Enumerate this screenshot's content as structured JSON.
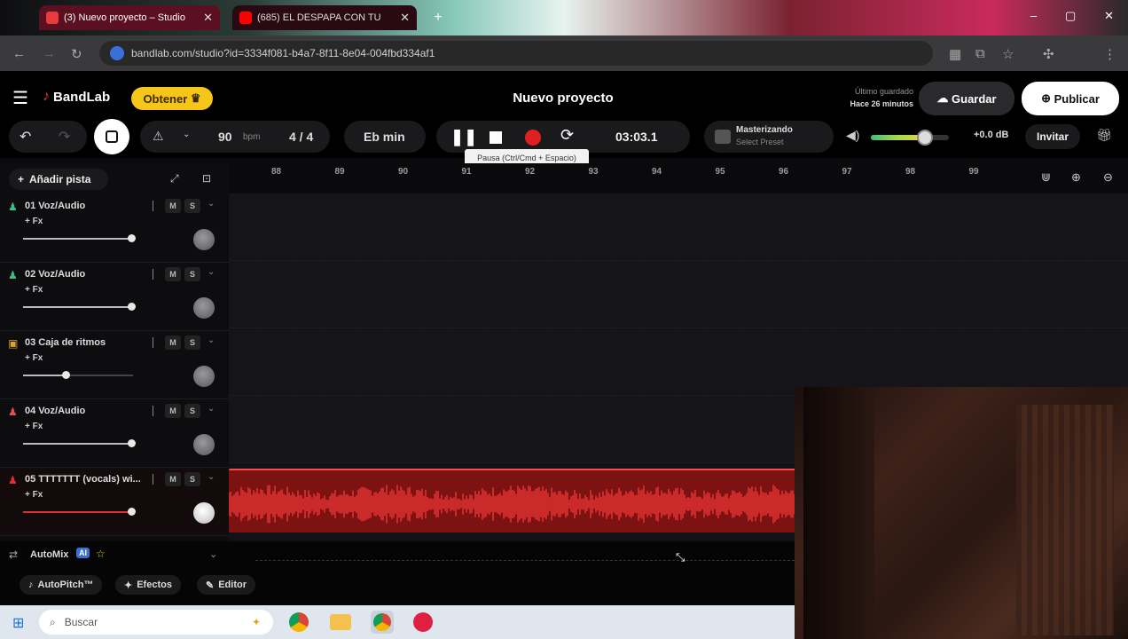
{
  "browser": {
    "tabs": [
      {
        "label": "(3) Nuevo proyecto – Studio",
        "active": true
      },
      {
        "label": "(685) EL DESPAPA CON TU",
        "active": false
      }
    ],
    "new_tab": "+",
    "url": "bandlab.com/studio?id=3334f081-b4a7-8f11-8e04-004fbd334af1",
    "window_controls": [
      "–",
      "▢",
      "✕"
    ]
  },
  "header": {
    "logo": "BandLab",
    "get_button": "Obtener",
    "project_title": "Nuevo proyecto",
    "last_saved_label": "Último guardado",
    "last_saved_value": "Hace 26 minutos",
    "save_button": "Guardar",
    "publish_button": "Publicar"
  },
  "transport": {
    "tempo": "90",
    "tempo_unit": "bpm",
    "time_signature": "4 / 4",
    "key": "Eb min",
    "time": "03:03.1",
    "mastering_title": "Masterizando",
    "mastering_preset": "Select Preset",
    "level": "+0.0 dB",
    "invite_button": "Invitar",
    "tooltip": "Pausa (Ctrl/Cmd + Espacio)"
  },
  "tracks_header": {
    "add_track": "Añadir pista"
  },
  "ruler": [
    "88",
    "89",
    "90",
    "91",
    "92",
    "93",
    "94",
    "95",
    "96",
    "97",
    "98",
    "99"
  ],
  "tracks": [
    {
      "name": "01  Voz/Audio",
      "fx": "+ Fx",
      "color": "#3fbf7f",
      "volume": 0.98
    },
    {
      "name": "02  Voz/Audio",
      "fx": "+ Fx",
      "color": "#3fbf7f",
      "volume": 0.98
    },
    {
      "name": "03  Caja de ritmos",
      "fx": "+ Fx",
      "color": "#e0a030",
      "volume": 0.39
    },
    {
      "name": "04  Voz/Audio",
      "fx": "+ Fx",
      "color": "#e05050",
      "volume": 0.98
    },
    {
      "name": "05  TTTTTTT (vocals) wi...",
      "fx": "+ Fx",
      "color": "#e03030",
      "volume": 0.98
    }
  ],
  "track_buttons": {
    "mute": "M",
    "solo": "S"
  },
  "bottom": {
    "autotune_label": "AutoMix",
    "autotune_badge": "AI",
    "autopitch": "AutoPitch™",
    "effects": "Efectos",
    "editor": "Editor"
  },
  "taskbar": {
    "search_placeholder": "Buscar"
  },
  "colors": {
    "accent": "#f5c518",
    "record": "#e02020",
    "clip": "#7d1212",
    "clip_wave": "#ff3a3a"
  }
}
